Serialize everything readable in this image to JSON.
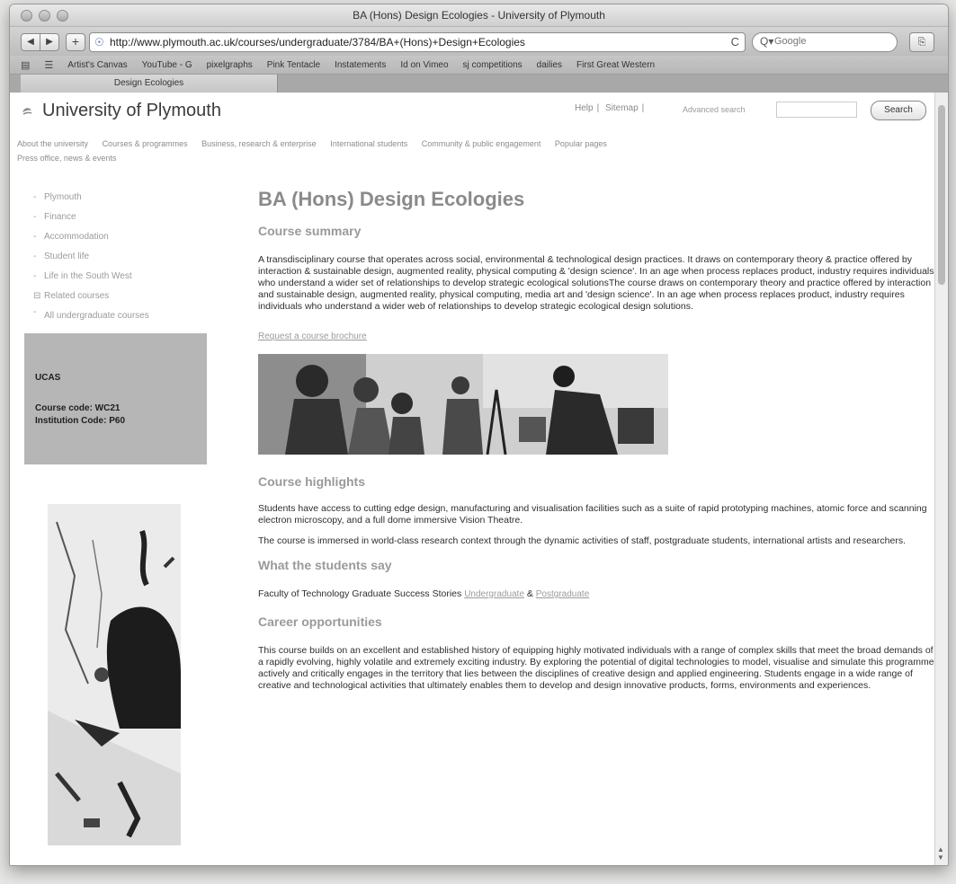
{
  "window": {
    "title": "BA (Hons) Design Ecologies - University of Plymouth"
  },
  "toolbar": {
    "back": "◀",
    "forward": "▶",
    "add": "+",
    "url": "http://www.plymouth.ac.uk/courses/undergraduate/3784/BA+(Hons)+Design+Ecologies",
    "reload": "C",
    "search_placeholder": "Google",
    "page_btn": "⎘"
  },
  "bookmarks": [
    "Artist's Canvas",
    "YouTube - G",
    "pixelgraphs",
    "Pink Tentacle",
    "Instatements",
    "Id on Vimeo",
    "sj competitions",
    "dailies",
    "First Great Western"
  ],
  "tab": {
    "label": "Design Ecologies"
  },
  "site": {
    "name": "University of Plymouth",
    "help": "Help",
    "sitemap": "Sitemap",
    "advanced_search": "Advanced search",
    "search_button": "Search"
  },
  "mainnav": [
    "About the university",
    "Courses & programmes",
    "Business, research & enterprise",
    "International students",
    "Community & public engagement",
    "Popular pages"
  ],
  "subnav": "Press office, news & events",
  "sidebar": {
    "links": [
      "Plymouth",
      "Finance",
      "Accommodation",
      "Student life",
      "Life in the South West",
      "Related courses",
      "All undergraduate courses"
    ],
    "ucas_title": "UCAS",
    "course_code": "Course code: WC21",
    "institution_code": "Institution Code: P60"
  },
  "main": {
    "title": "BA (Hons) Design Ecologies",
    "summary_heading": "Course summary",
    "summary_text": "A transdisciplinary course that operates across social, environmental & technological design practices. It draws on contemporary theory & practice offered by interaction & sustainable design, augmented reality, physical computing & 'design science'. In an age when process replaces product, industry requires individuals who understand a wider set of relationships to develop strategic ecological solutionsThe course draws on contemporary theory and practice offered by interaction and sustainable design, augmented reality, physical computing, media art and 'design science'. In an age when process replaces product, industry requires individuals who understand a wider web of relationships to develop strategic ecological design solutions.",
    "brochure_link": "Request a course brochure",
    "highlights_heading": "Course highlights",
    "highlights_p1": "Students have access to cutting edge design, manufacturing and visualisation facilities such as a suite of rapid prototyping machines, atomic force and scanning electron microscopy, and a full dome immersive Vision Theatre.",
    "highlights_p2": "The course is immersed in world-class research context through the dynamic activities of staff, postgraduate students, international artists and researchers.",
    "students_heading": "What the students say",
    "students_text": "Faculty of Technology Graduate Success Stories",
    "undergraduate_link": "Undergraduate",
    "amp": "&",
    "postgraduate_link": "Postgraduate",
    "career_heading": "Career opportunities",
    "career_text": "This course builds on an excellent and established history of equipping highly motivated individuals with a range of complex skills that meet the broad demands of a rapidly evolving, highly volatile and extremely exciting industry. By exploring the potential of digital technologies to model, visualise and simulate this programme actively and critically engages in the territory that lies between the disciplines of creative design and applied engineering. Students engage in a wide range of creative and technological activities that ultimately enables them to develop and design innovative products, forms, environments and experiences."
  }
}
